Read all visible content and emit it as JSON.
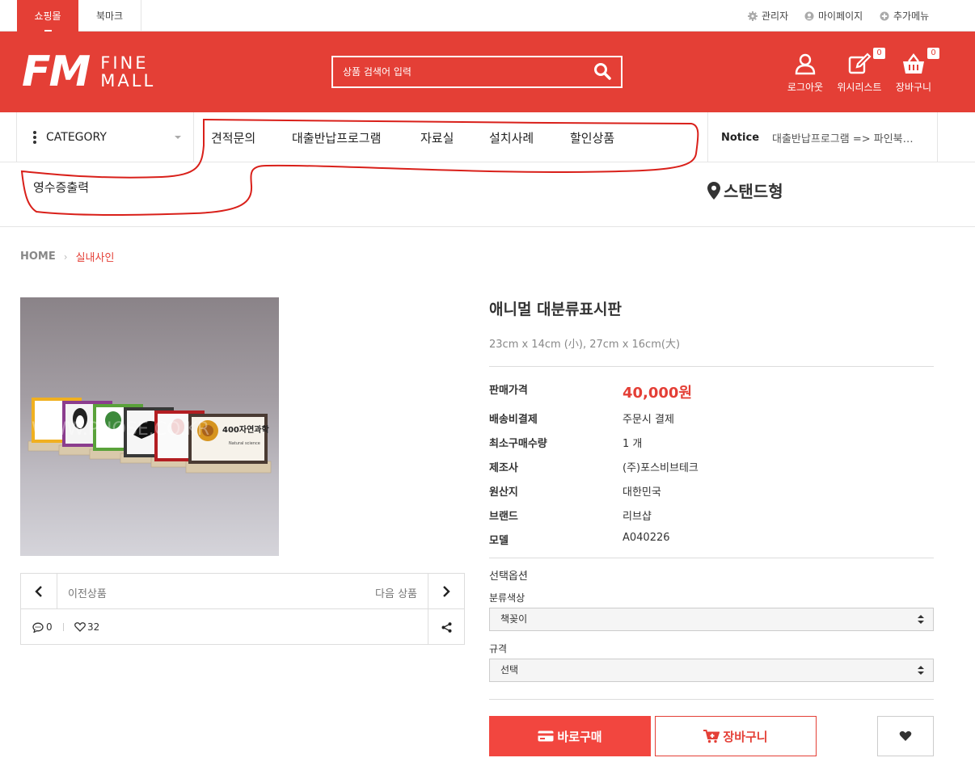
{
  "topbar": {
    "tabs": [
      "쇼핑몰",
      "북마크"
    ],
    "util": [
      "관리자",
      "마이페이지",
      "추가메뉴"
    ]
  },
  "header": {
    "logo_main": "FM",
    "logo_sub1": "FINE",
    "logo_sub2": "MALL",
    "search_placeholder": "상품 검색어 입력",
    "logout": "로그아웃",
    "wishlist": "위시리스트",
    "wishlist_count": "0",
    "cart": "장바구니",
    "cart_count": "0"
  },
  "nav": {
    "category": "CATEGORY",
    "menu": [
      "견적문의",
      "대출반납프로그램",
      "자료실",
      "설치사례",
      "할인상품"
    ],
    "notice_label": "Notice",
    "notice_text": "대출반납프로그램 => 파인북…",
    "receipt": "영수증출력",
    "location": "스탠드형"
  },
  "breadcrumb": {
    "home": "HOME",
    "current": "실내사인"
  },
  "image": {
    "watermark": "WWW.PHOSE.CO.KR",
    "card_title": "400자연과학",
    "card_sub": "Natural science"
  },
  "pager": {
    "prev": "이전상품",
    "next": "다음 상품",
    "comments": "0",
    "likes": "32"
  },
  "product": {
    "title": "애니멀 대분류표시판",
    "size": "23cm x 14cm (小), 27cm x 16cm(大)",
    "specs": [
      {
        "k": "판매가격",
        "v": "40,000원"
      },
      {
        "k": "배송비결제",
        "v": "주문시 결제"
      },
      {
        "k": "최소구매수량",
        "v": "1 개"
      },
      {
        "k": "제조사",
        "v": "(주)포스비브테크"
      },
      {
        "k": "원산지",
        "v": "대한민국"
      },
      {
        "k": "브랜드",
        "v": "리브샵"
      },
      {
        "k": "모델",
        "v": "A040226"
      }
    ],
    "option_title": "선택옵션",
    "opt1_label": "분류색상",
    "opt1_value": "책꽂이",
    "opt2_label": "규격",
    "opt2_value": "선택",
    "buy": "바로구매",
    "add_cart": "장바구니"
  },
  "colors": {
    "brand_red": "#e43f36",
    "button_red": "#f2463f"
  }
}
